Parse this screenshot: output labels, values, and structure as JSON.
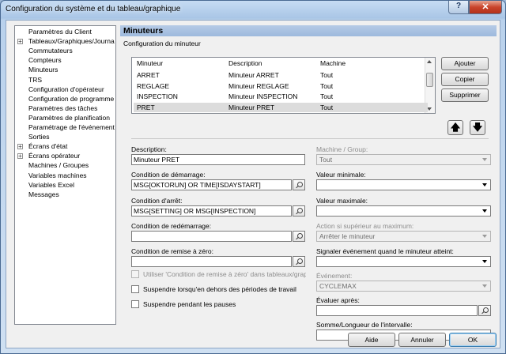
{
  "window": {
    "title": "Configuration du système et du tableau/graphique",
    "help_label": "?",
    "close_label": "✕"
  },
  "tree": {
    "items": [
      {
        "label": "Paramètres du Client",
        "expandable": false
      },
      {
        "label": "Tableaux/Graphiques/Journa",
        "expandable": true
      },
      {
        "label": "Commutateurs",
        "expandable": false
      },
      {
        "label": "Compteurs",
        "expandable": false
      },
      {
        "label": "Minuteurs",
        "expandable": false
      },
      {
        "label": "TRS",
        "expandable": false
      },
      {
        "label": "Configuration d'opérateur",
        "expandable": false
      },
      {
        "label": "Configuration de programme",
        "expandable": false
      },
      {
        "label": "Paramètres des tâches",
        "expandable": false
      },
      {
        "label": "Paramètres de planification",
        "expandable": false
      },
      {
        "label": "Paramétrage de l'événement",
        "expandable": false
      },
      {
        "label": "Sorties",
        "expandable": false
      },
      {
        "label": "Écrans d'état",
        "expandable": true
      },
      {
        "label": "Écrans opérateur",
        "expandable": true
      },
      {
        "label": "Machines / Groupes",
        "expandable": false
      },
      {
        "label": "Variables machines",
        "expandable": false
      },
      {
        "label": "Variables Excel",
        "expandable": false
      },
      {
        "label": "Messages",
        "expandable": false
      }
    ]
  },
  "pane": {
    "title": "Minuteurs",
    "subtitle": "Configuration du minuteur",
    "table": {
      "headers": [
        "Minuteur",
        "Description",
        "Machine"
      ],
      "rows": [
        [
          "ARRET",
          "Minuteur ARRET",
          "Tout"
        ],
        [
          "REGLAGE",
          "Minuteur REGLAGE",
          "Tout"
        ],
        [
          "INSPECTION",
          "Minuteur INSPECTION",
          "Tout"
        ],
        [
          "PRET",
          "Minuteur PRET",
          "Tout"
        ]
      ],
      "selected_row": 3
    },
    "buttons": {
      "add": "Ajouter",
      "copy": "Copier",
      "delete": "Supprimer",
      "up": "🡅",
      "down": "🡇"
    },
    "form": {
      "description_label": "Description:",
      "description_value": "Minuteur PRET",
      "start_label": "Condition de démarrage:",
      "start_value": "MSG[OKTORUN] OR TIME[ISDAYSTART]",
      "stop_label": "Condition d'arrêt:",
      "stop_value": "MSG[SETTING] OR MSG[INSPECTION]",
      "restart_label": "Condition de redémarrage:",
      "restart_value": "",
      "reset_label": "Condition de remise à zéro:",
      "reset_value": "",
      "use_reset_label": "Utiliser 'Condition de remise à zéro' dans tableaux/graphic",
      "suspend_outside_label": "Suspendre lorsqu'en dehors des périodes de travail",
      "suspend_pause_label": "Suspendre pendant les pauses",
      "machine_group_label": "Machine / Group:",
      "machine_group_value": "Tout",
      "min_label": "Valeur minimale:",
      "min_value": "",
      "max_label": "Valeur maximale:",
      "max_value": "",
      "action_label": "Action si supérieur au maximum:",
      "action_value": "Arrêter le minuteur",
      "signal_label": "Signaler événement quand le minuteur atteint:",
      "signal_value": "",
      "event_label": "Événement:",
      "event_value": "CYCLEMAX",
      "evaluate_label": "Évaluer après:",
      "evaluate_value": "",
      "interval_label": "Somme/Longueur de l'intervalle:",
      "interval_value": ""
    }
  },
  "footer": {
    "help": "Aide",
    "cancel": "Annuler",
    "ok": "OK"
  }
}
